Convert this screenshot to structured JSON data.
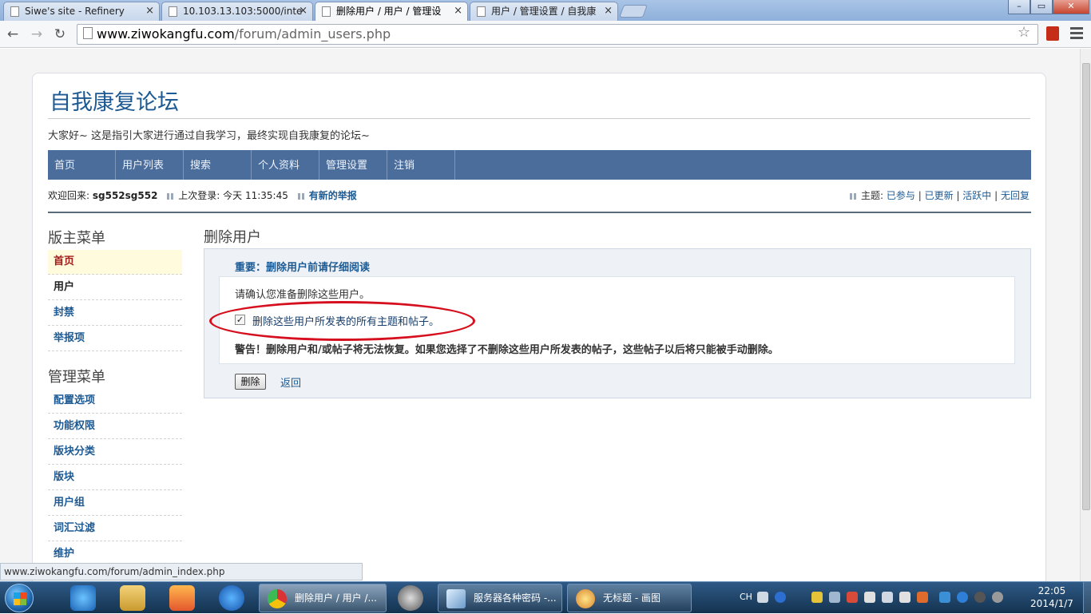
{
  "browser": {
    "tabs": [
      {
        "title": "Siwe's site - Refinery",
        "close": "×"
      },
      {
        "title": "10.103.13.103:5000/inte",
        "close": "×"
      },
      {
        "title": "删除用户 / 用户 / 管理设",
        "close": "×"
      },
      {
        "title": "用户 / 管理设置 / 自我康",
        "close": "×"
      }
    ],
    "url_host": "www.ziwokangfu.com",
    "url_path": "/forum/admin_users.php",
    "nav": {
      "back": "←",
      "forward": "→",
      "reload": "↻",
      "star": "☆"
    },
    "window": {
      "min": "–",
      "max": "▭",
      "close": "✕"
    }
  },
  "site": {
    "title": "自我康复论坛",
    "description": "大家好~ 这是指引大家进行通过自我学习，最终实现自我康复的论坛~",
    "nav": [
      "首页",
      "用户列表",
      "搜索",
      "个人资料",
      "管理设置",
      "注销"
    ],
    "welcome_label": "欢迎回来:",
    "username": "sg552sg552",
    "last_login_label": "上次登录:",
    "last_login_value": "今天 11:35:45",
    "new_reports": "有新的举报",
    "topics_label": "主题:",
    "topic_links": [
      "已参与",
      "已更新",
      "活跃中",
      "无回复"
    ]
  },
  "sidebar": {
    "mod_head": "版主菜单",
    "mod_items": [
      "首页",
      "用户",
      "封禁",
      "举报项"
    ],
    "admin_head": "管理菜单",
    "admin_items": [
      "配置选项",
      "功能权限",
      "版块分类",
      "版块",
      "用户组",
      "词汇过滤",
      "维护"
    ]
  },
  "main": {
    "title": "删除用户",
    "panel_head": "重要：删除用户前请仔细阅读",
    "confirm": "请确认您准备删除这些用户。",
    "checkbox_label": "删除这些用户所发表的所有主题和帖子。",
    "checkbox_checked": true,
    "check_mark": "✓",
    "warning": "警告！删除用户和/或帖子将无法恢复。如果您选择了不删除这些用户所发表的帖子，这些帖子以后将只能被手动删除。",
    "delete_button": "删除",
    "back_link": "返回"
  },
  "status_url": "www.ziwokangfu.com/forum/admin_index.php",
  "taskbar": {
    "tasks": [
      "删除用户 / 用户 /...",
      "服务器各种密码 -...",
      "无标题 - 画图"
    ],
    "lang": "CH",
    "time": "22:05",
    "date": "2014/1/7"
  }
}
